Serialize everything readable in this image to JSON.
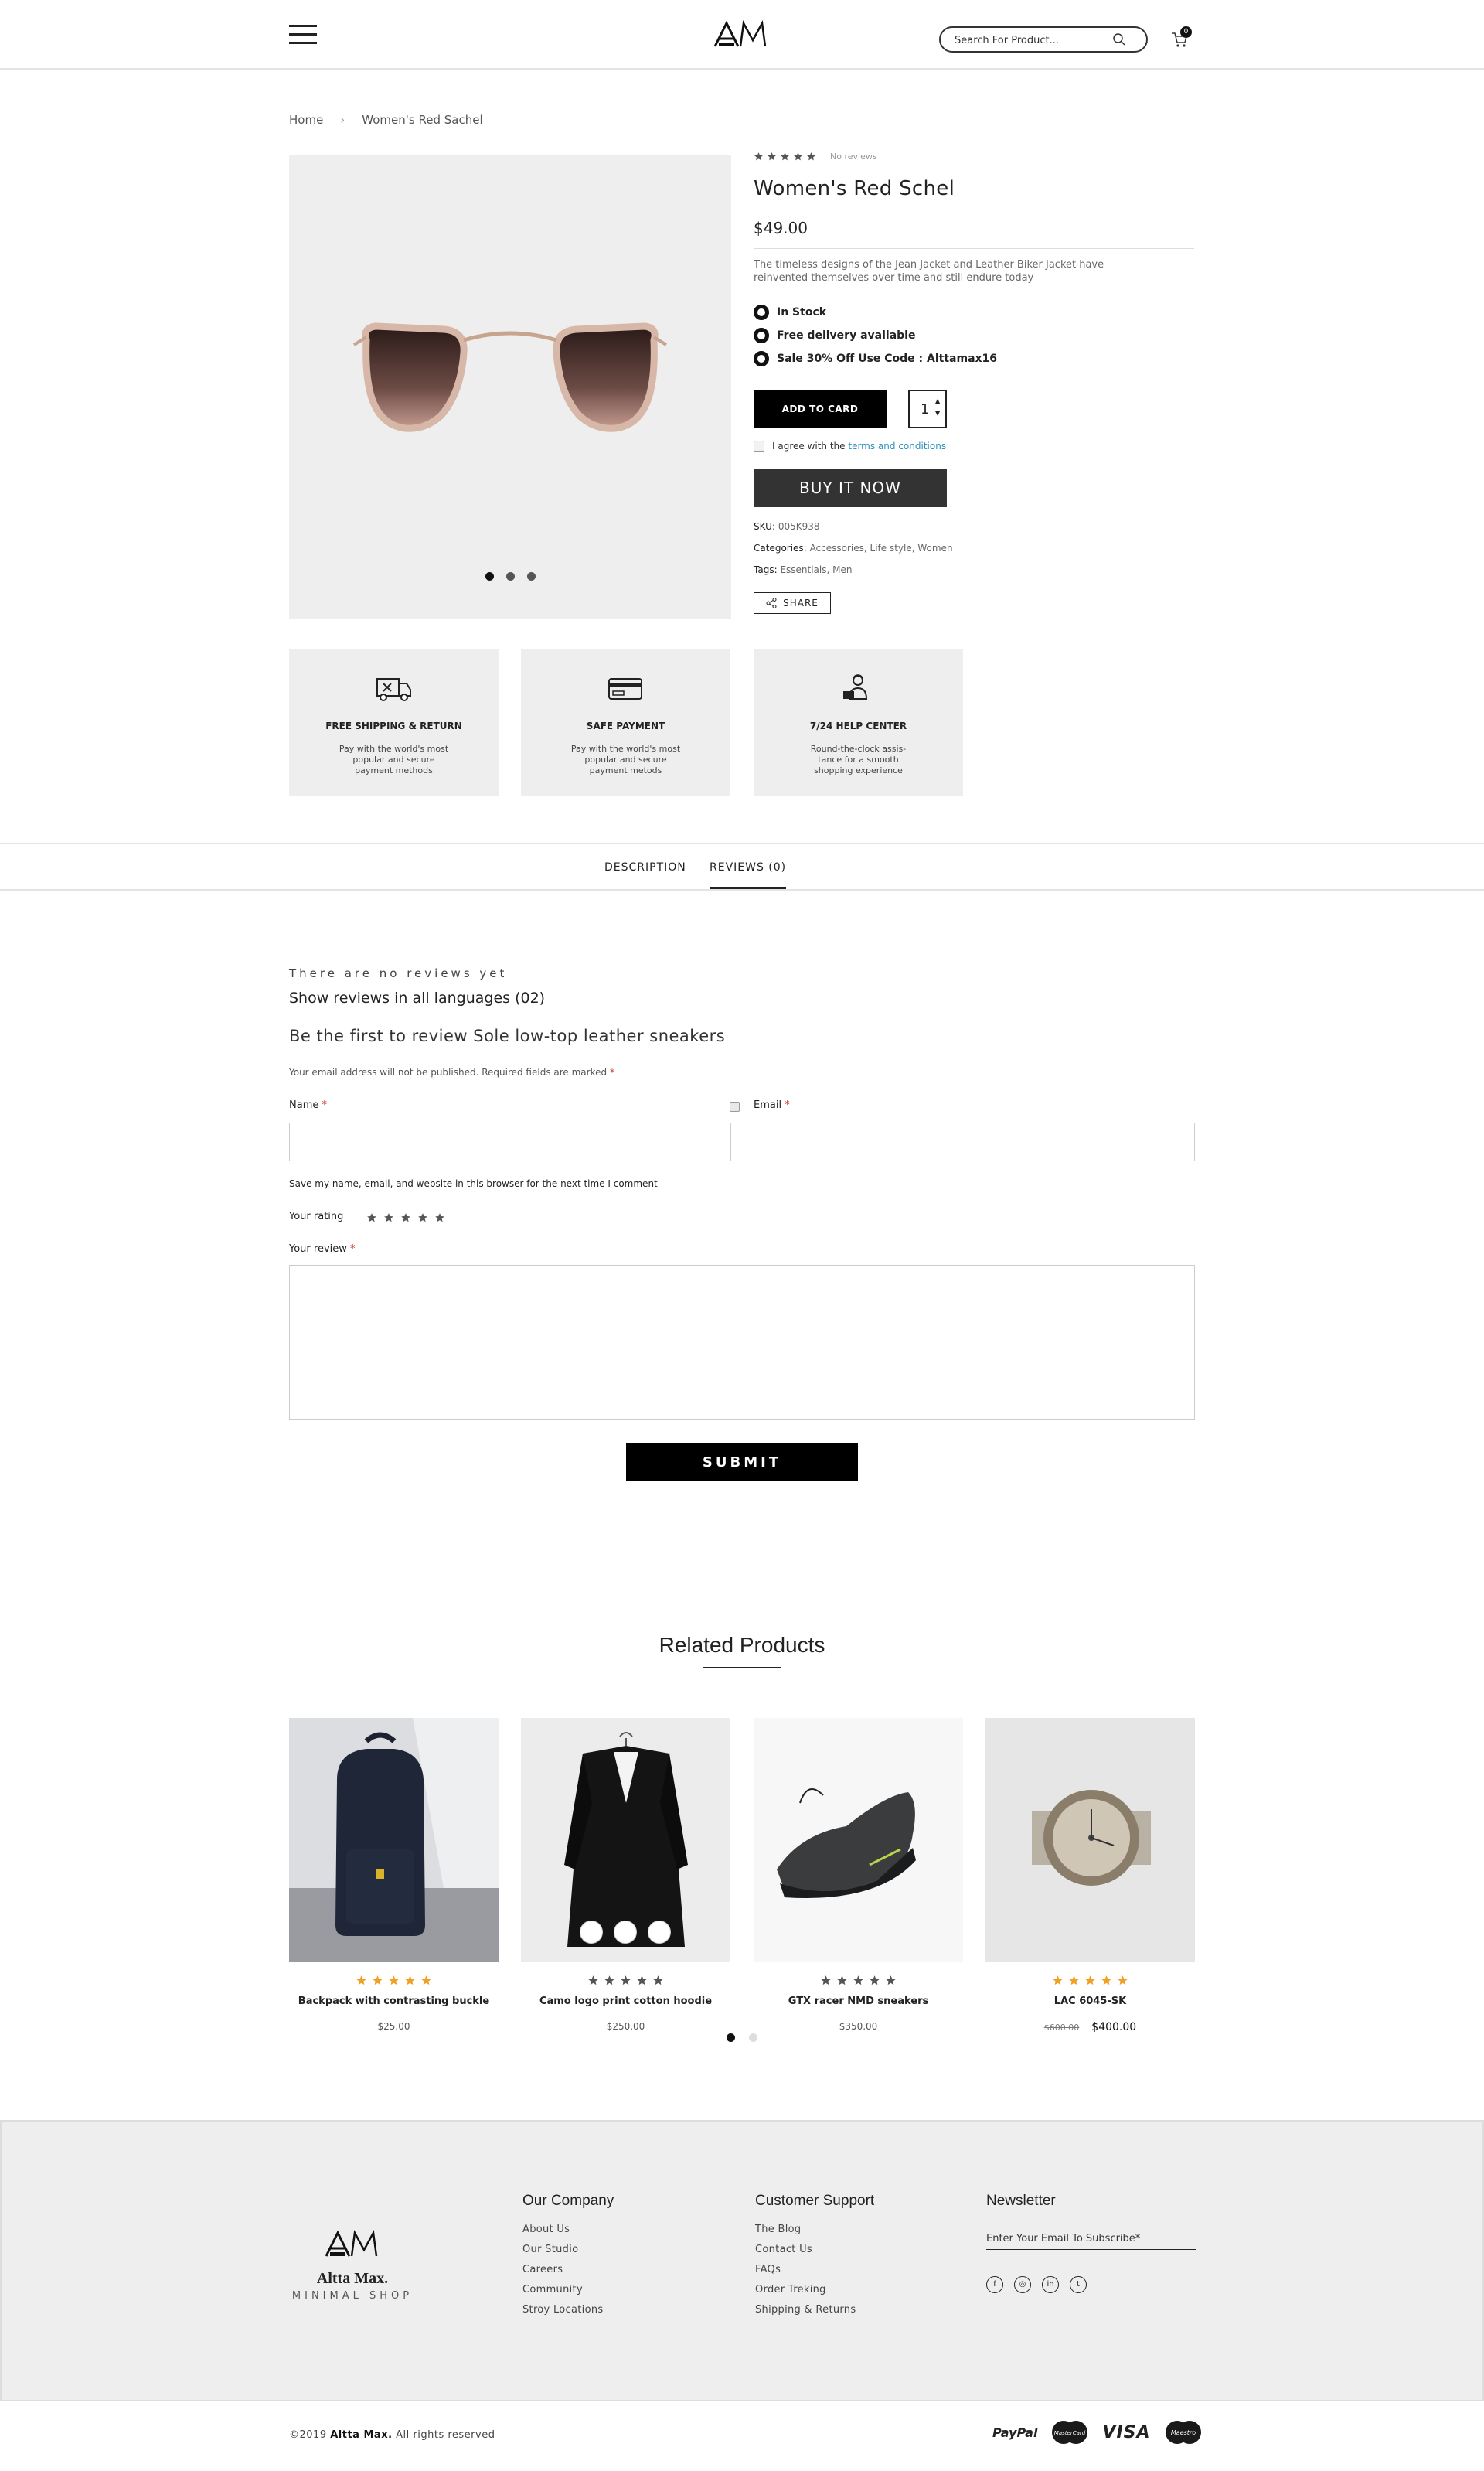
{
  "header": {
    "search_placeholder": "Search For Product...",
    "cart_count": "0"
  },
  "breadcrumb": {
    "home": "Home",
    "sep": "›",
    "current": "Women's Red Sachel"
  },
  "product": {
    "reviews_count": "No reviews",
    "title": "Women's Red Schel",
    "price": "$49.00",
    "description": "The timeless designs of the Jean Jacket and Leather Biker Jacket have reinvented themselves over time and still endure today",
    "features": [
      "In Stock",
      "Free delivery available",
      "Sale 30% Off Use Code : Alttamax16"
    ],
    "add_button": "ADD TO CARD",
    "quantity": "1",
    "agree_text": "I agree with the",
    "terms_link": "terms and conditions",
    "buy_button": "BUY IT NOW",
    "sku_label": "SKU:",
    "sku": "005K938",
    "categories_label": "Categories:",
    "categories": "Accessories, Life style, Women",
    "tags_label": "Tags:",
    "tags": "Essentials, Men",
    "share_label": "SHARE",
    "gallery_slides": 3,
    "gallery_active": 1
  },
  "features": [
    {
      "title": "FREE SHIPPING & RETURN",
      "desc": "Pay with the world's most popular and secure payment methods",
      "icon": "truck-icon"
    },
    {
      "title": "SAFE PAYMENT",
      "desc": "Pay with the world's most popular and secure payment metods",
      "icon": "credit-card-icon"
    },
    {
      "title": "7/24 HELP CENTER",
      "desc": "Round-the-clock assis-tance for a smooth shopping experience",
      "icon": "support-agent-icon"
    }
  ],
  "tabs": {
    "description": "DESCRIPTION",
    "reviews": "REVIEWS (0)"
  },
  "reviews": {
    "none_text": "There are no reviews yet",
    "show_all": "Show reviews in all languages  (02)",
    "first_review": "Be the first to review Sole low-top leather sneakers",
    "note": "Your email address will not be published. Required fields are marked",
    "name_label": "Name",
    "email_label": "Email",
    "req": "*",
    "save_text": "Save my name, email, and website in this browser for the next time I comment",
    "rating_label": "Your rating",
    "review_label": "Your review",
    "submit": "SUBMIT"
  },
  "related": {
    "title": "Related Products",
    "products": [
      {
        "name": "Backpack with contrasting buckle",
        "price": "$25.00",
        "rating": 5,
        "star_color": "#f0a023"
      },
      {
        "name": "Camo logo print cotton hoodie",
        "price": "$250.00",
        "rating": 5,
        "star_color": "#555555"
      },
      {
        "name": "GTX racer NMD sneakers",
        "price": "$350.00",
        "rating": 5,
        "star_color": "#555555"
      },
      {
        "name": "LAC 6045-SK",
        "old_price": "$600.00",
        "price": "$400.00",
        "rating": 5,
        "star_color": "#f0a023"
      }
    ]
  },
  "footer": {
    "brand": "Altta Max.",
    "tagline": "MINIMAL SHOP",
    "company_title": "Our Company",
    "company_links": [
      "About Us",
      "Our Studio",
      "Careers",
      "Community",
      "Stroy Locations"
    ],
    "support_title": "Customer Support",
    "support_links": [
      "The Blog",
      "Contact Us",
      "FAQs",
      "Order Treking",
      "Shipping & Returns"
    ],
    "newsletter_title": "Newsletter",
    "newsletter_placeholder": "Enter Your Email To Subscribe*",
    "social": [
      "facebook-icon",
      "instagram-icon",
      "linkedin-icon",
      "twitter-icon"
    ],
    "social_glyphs": [
      "f",
      "◎",
      "in",
      "t"
    ],
    "copyright_prefix": "©2019",
    "copyright_brand": "Altta Max.",
    "copyright_suffix": "All rights reserved",
    "payments": {
      "paypal": "PayPal",
      "mastercard": "MasterCard",
      "visa": "VISA",
      "maestro": "Maestro"
    }
  }
}
